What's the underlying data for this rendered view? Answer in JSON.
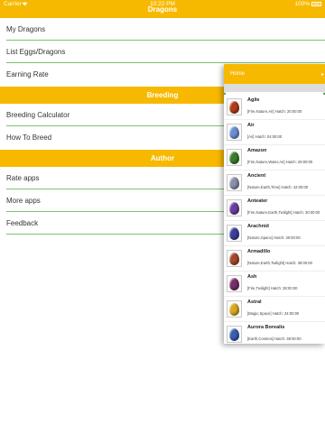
{
  "status_bar": {
    "carrier": "Carrier",
    "time": "10:22 PM",
    "battery": "100%"
  },
  "nav": {
    "title": "Dragons"
  },
  "menu": {
    "items_top": [
      "My Dragons",
      "List Eggs/Dragons",
      "Earning Rate"
    ],
    "section_breeding": "Breeding",
    "items_breeding": [
      "Breeding Calculator",
      "How To Breed"
    ],
    "section_author": "Author",
    "items_author": [
      "Rate apps",
      "More apps",
      "Feedback"
    ]
  },
  "popover": {
    "home_label": "Home",
    "search_placeholder": "",
    "dragons": [
      {
        "name": "Agile",
        "desc": "[Fire,Nature,Air] Hatch: 20:00:00",
        "egg_color": "#b23c1a"
      },
      {
        "name": "Air",
        "desc": "[Air] Hatch: 04:00:00",
        "egg_color": "#6a8fd0"
      },
      {
        "name": "Amazon",
        "desc": "[Fire,Nature,Water,Air] Hatch: 28:00:00",
        "egg_color": "#3a7d2a"
      },
      {
        "name": "Ancient",
        "desc": "[Nature,Earth,Time] Hatch: 42:00:00",
        "egg_color": "#8a8fa8"
      },
      {
        "name": "Anteater",
        "desc": "[Fire,Nature,Earth,Twilight] Hatch: 30:00:00",
        "egg_color": "#6b3fa0"
      },
      {
        "name": "Arachnid",
        "desc": "[Nature,Space] Hatch: 30:00:00",
        "egg_color": "#3b3f9a"
      },
      {
        "name": "Armadillo",
        "desc": "[Nature,Earth,Twilight] Hatch: 38:00:00",
        "egg_color": "#a34a2a"
      },
      {
        "name": "Ash",
        "desc": "[Fire,Twilight] Hatch: 28:00:00",
        "egg_color": "#7a2f6a"
      },
      {
        "name": "Astral",
        "desc": "[Magic,Space] Hatch: 34:00:00",
        "egg_color": "#d9a81e"
      },
      {
        "name": "Aurora Borealis",
        "desc": "[Earth,Cosmos] Hatch: 38:00:00",
        "egg_color": "#3a5fb0"
      }
    ]
  }
}
